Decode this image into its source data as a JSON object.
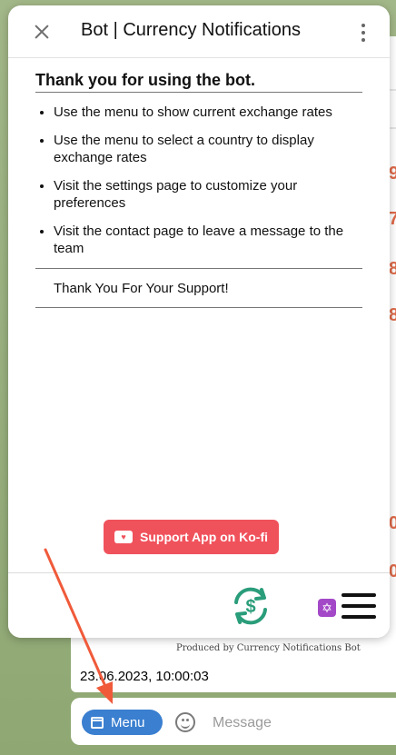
{
  "modal": {
    "title": "Bot | Currency Notifications",
    "heading": "Thank you for using the bot.",
    "bullets": [
      "Use the menu to show current exchange rates",
      "Use the menu to select a country to display exchange rates",
      "Visit the settings page to customize your preferences",
      "Visit the contact page to leave a message to the team"
    ],
    "thanks": "Thank You For Your Support!",
    "kofi_label": "Support App on Ko-fi"
  },
  "bottom_nav": {
    "icons": [
      "currency-exchange-icon",
      "star-of-david-icon",
      "hamburger-menu-icon"
    ]
  },
  "chat": {
    "produced_by": "Produced by Currency Notifications Bot",
    "timestamp": "23.06.2023, 10:00:03"
  },
  "composer": {
    "menu_label": "Menu",
    "message_placeholder": "Message"
  },
  "colors": {
    "kofi": "#f0525c",
    "menu_button": "#3a7fd0",
    "exchange_icon": "#2a9d7a",
    "arrow": "#f05a3a"
  }
}
